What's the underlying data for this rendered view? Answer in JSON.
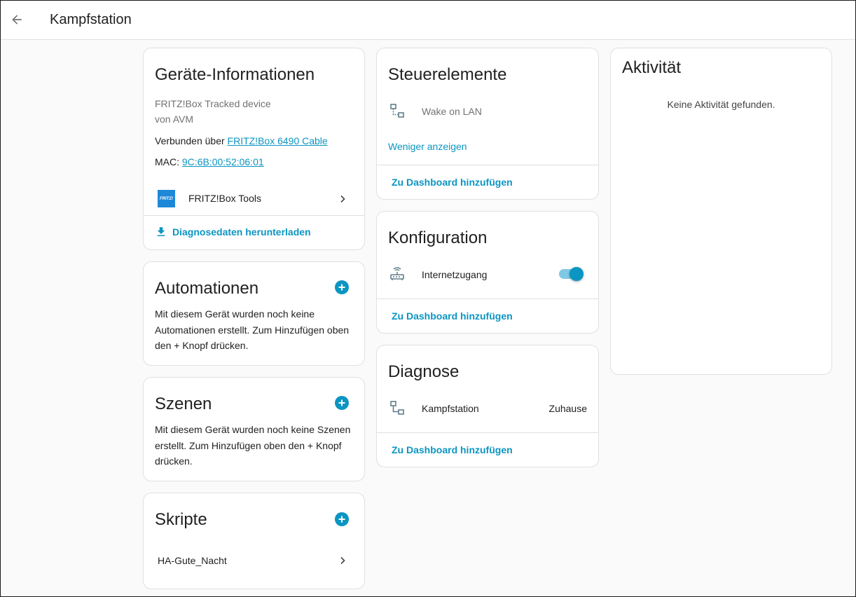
{
  "header": {
    "title": "Kampfstation",
    "back_icon": "arrow-left-icon"
  },
  "device_info": {
    "title": "Geräte-Informationen",
    "model": "FRITZ!Box Tracked device",
    "manufacturer": "von AVM",
    "connected_prefix": "Verbunden über",
    "connected_link": "FRITZ!Box 6490 Cable",
    "mac_prefix": "MAC:",
    "mac_value": "9C:6B:00:52:06:01",
    "integration_label": "FRITZ!Box Tools",
    "integration_logo_text": "FRITZ!",
    "download_label": "Diagnosedaten herunterladen"
  },
  "automations": {
    "title": "Automationen",
    "text": "Mit diesem Gerät wurden noch keine Automationen erstellt. Zum Hinzufügen oben den + Knopf drücken."
  },
  "scenes": {
    "title": "Szenen",
    "text": "Mit diesem Gerät wurden noch keine Szenen erstellt. Zum Hinzufügen oben den + Knopf drücken."
  },
  "scripts": {
    "title": "Skripte",
    "items": [
      {
        "label": "HA-Gute_Nacht"
      }
    ]
  },
  "controls": {
    "title": "Steuerelemente",
    "entity_label": "Wake on LAN",
    "show_less": "Weniger anzeigen",
    "add_dashboard": "Zu Dashboard hinzufügen"
  },
  "configuration": {
    "title": "Konfiguration",
    "entity_label": "Internetzugang",
    "toggle_on": true,
    "add_dashboard": "Zu Dashboard hinzufügen"
  },
  "diagnostics": {
    "title": "Diagnose",
    "entity_label": "Kampfstation",
    "entity_state": "Zuhause",
    "add_dashboard": "Zu Dashboard hinzufügen"
  },
  "activity": {
    "title": "Aktivität",
    "empty_text": "Keine Aktivität gefunden."
  },
  "colors": {
    "accent": "#0b95c2",
    "toggle_track": "#80c8e5",
    "background": "#fafafa"
  }
}
